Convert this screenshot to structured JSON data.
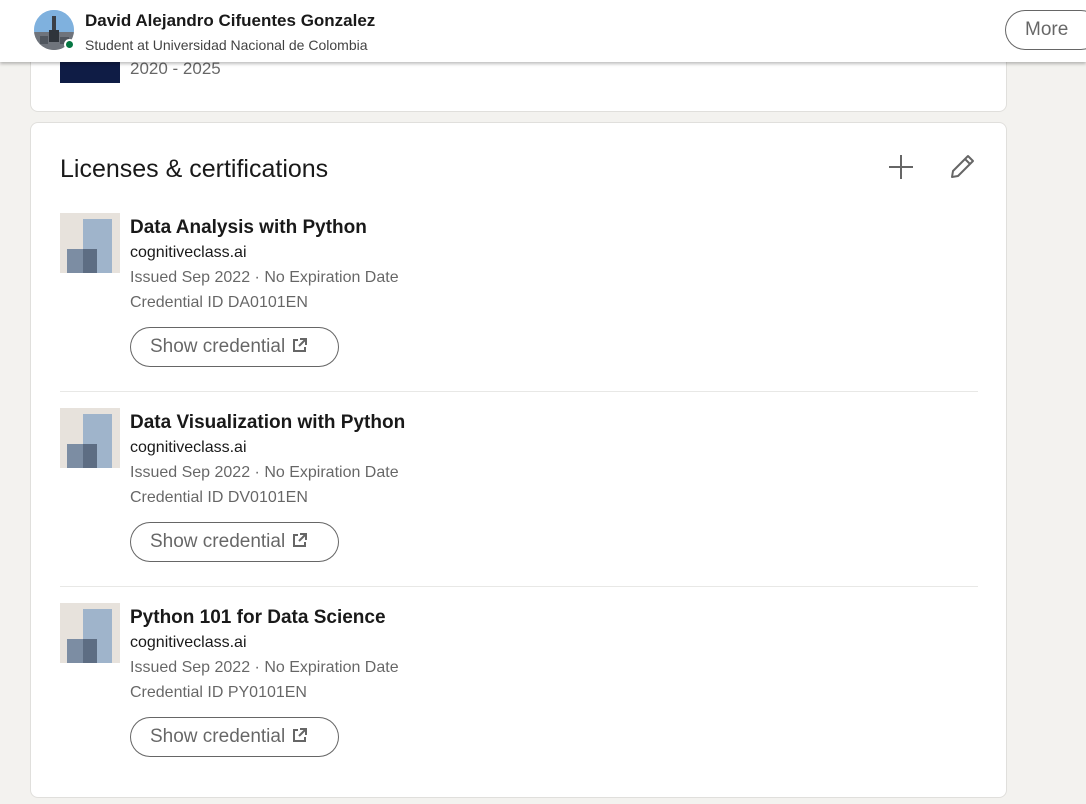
{
  "header": {
    "name": "David Alejandro Cifuentes Gonzalez",
    "headline": "Student at Universidad Nacional de Colombia",
    "more_label": "More",
    "presence_color": "#057642"
  },
  "education": {
    "dates": "2020 - 2025"
  },
  "licenses": {
    "title": "Licenses & certifications",
    "icons": {
      "add": "plus-icon",
      "edit": "pencil-icon",
      "external": "external-link-icon"
    },
    "items": [
      {
        "name": "Data Analysis with Python",
        "issuer": "cognitiveclass.ai",
        "issued": "Issued Sep 2022 · No Expiration Date",
        "credential_id": "Credential ID DA0101EN",
        "button_label": "Show credential"
      },
      {
        "name": "Data Visualization with Python",
        "issuer": "cognitiveclass.ai",
        "issued": "Issued Sep 2022 · No Expiration Date",
        "credential_id": "Credential ID DV0101EN",
        "button_label": "Show credential"
      },
      {
        "name": "Python 101 for Data Science",
        "issuer": "cognitiveclass.ai",
        "issued": "Issued Sep 2022 · No Expiration Date",
        "credential_id": "Credential ID PY0101EN",
        "button_label": "Show credential"
      }
    ]
  },
  "colors": {
    "page_background": "#f3f2ef",
    "card_background": "#ffffff",
    "school_logo": "#0f1c45"
  }
}
